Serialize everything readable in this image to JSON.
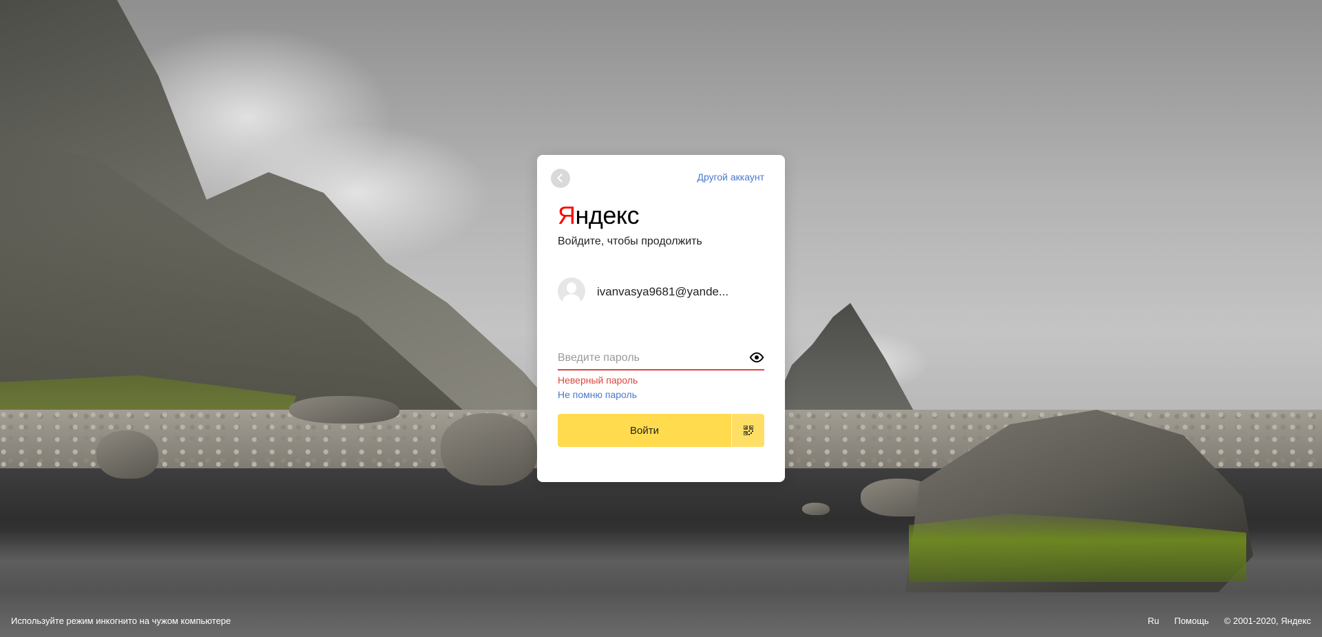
{
  "login": {
    "other_account": "Другой аккаунт",
    "logo_first": "Я",
    "logo_rest": "ндекс",
    "subtitle": "Войдите, чтобы продолжить",
    "account_email": "ivanvasya9681@yande...",
    "password_placeholder": "Введите пароль",
    "error_text": "Неверный пароль",
    "forgot_link": "Не помню пароль",
    "submit_label": "Войти"
  },
  "footer": {
    "incognito_hint": "Используйте режим инкогнито на чужом компьютере",
    "lang": "Ru",
    "help": "Помощь",
    "copyright": "© 2001-2020, Яндекс"
  },
  "colors": {
    "accent_yellow": "#ffdb4d",
    "link_blue": "#4a76d0",
    "error_red": "#e0443b",
    "logo_red": "#ff0000"
  },
  "icons": {
    "back": "chevron-left-icon",
    "toggle_password": "eye-icon",
    "qr": "qr-code-icon",
    "avatar": "user-avatar-icon"
  }
}
